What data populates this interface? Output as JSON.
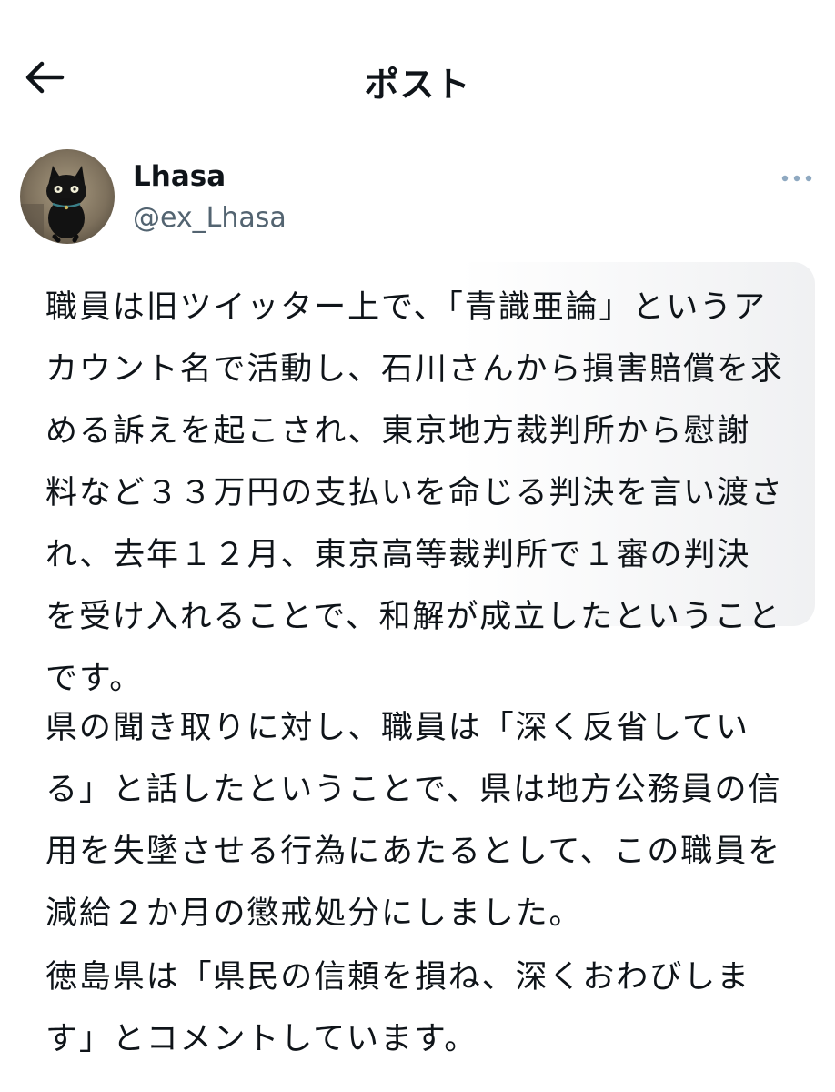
{
  "header": {
    "title": "ポスト",
    "back_icon": "arrow-left-icon"
  },
  "author": {
    "display_name": "Lhasa",
    "handle": "@ex_Lhasa",
    "avatar": "black-cat-avatar",
    "more_icon": "more-horizontal-icon"
  },
  "post": {
    "paragraphs": [
      "職員は旧ツイッター上で、「青識亜論」というアカウント名で活動し、石川さんから損害賠償を求める訴えを起こされ、東京地方裁判所から慰謝料など３３万円の支払いを命じる判決を言い渡され、去年１２月、東京高等裁判所で１審の判決を受け入れることで、和解が成立したということです。",
      "県の聞き取りに対し、職員は「深く反省している」と話したということで、県は地方公務員の信用を失墜させる行為にあたるとして、この職員を減給２か月の懲戒処分にしました。",
      "徳島県は「県民の信頼を損ね、深くおわびします」とコメントしています。"
    ]
  },
  "colors": {
    "text": "#0f1419",
    "secondary_text": "#536471",
    "more_icon": "#8fa9c1",
    "background": "#ffffff"
  }
}
